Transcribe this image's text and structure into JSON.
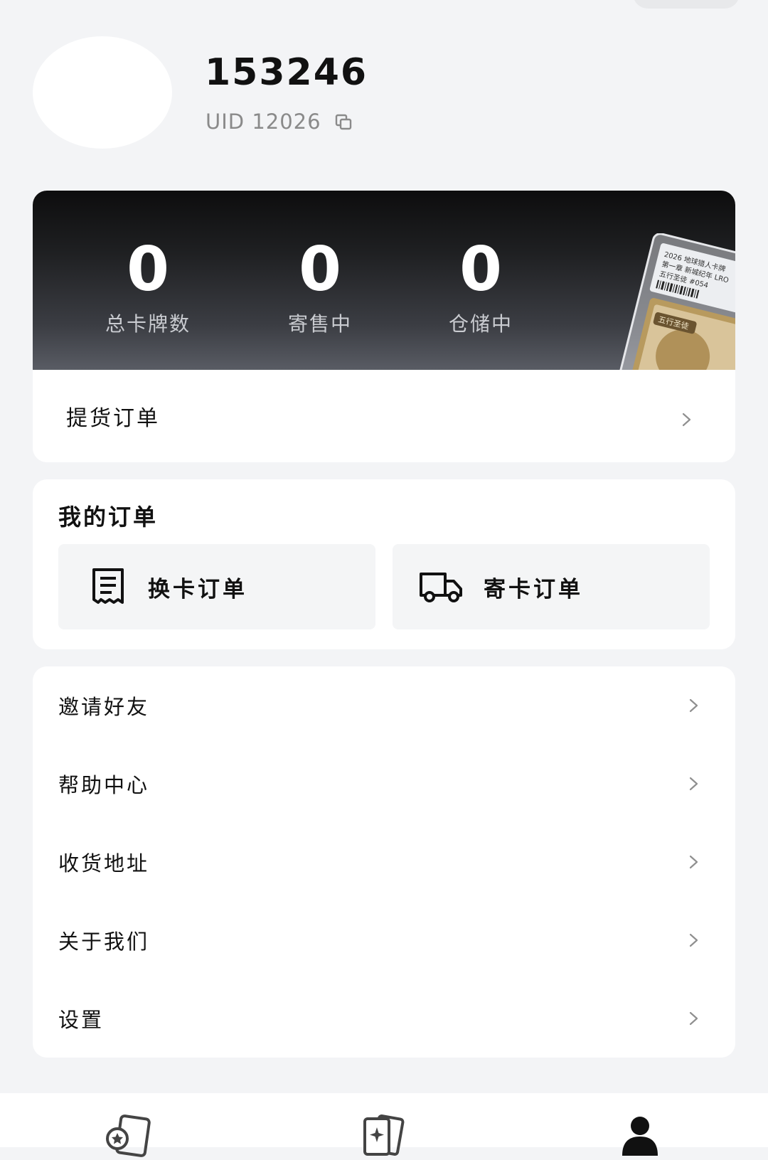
{
  "profile": {
    "username": "153246",
    "uid": "UID 12026"
  },
  "stats": [
    {
      "value": "0",
      "label": "总卡牌数"
    },
    {
      "value": "0",
      "label": "寄售中"
    },
    {
      "value": "0",
      "label": "仓储中"
    }
  ],
  "slab_card": {
    "line1": "2026 地球猎人卡牌",
    "line2": "第一章 新城纪年 LRO",
    "line3": "五行圣徒 #054",
    "badge": "五行圣徒"
  },
  "pickup_order": {
    "label": "提货订单"
  },
  "my_orders": {
    "title": "我的订单",
    "items": [
      {
        "label": "换卡订单",
        "icon": "receipt-icon"
      },
      {
        "label": "寄卡订单",
        "icon": "truck-icon"
      }
    ]
  },
  "menu": {
    "items": [
      {
        "label": "邀请好友"
      },
      {
        "label": "帮助中心"
      },
      {
        "label": "收货地址"
      },
      {
        "label": "关于我们"
      },
      {
        "label": "设置"
      }
    ]
  },
  "bottom_nav": {
    "items": [
      {
        "icon": "card-draw-icon"
      },
      {
        "icon": "card-collection-icon"
      },
      {
        "icon": "user-icon",
        "active": true
      }
    ]
  }
}
